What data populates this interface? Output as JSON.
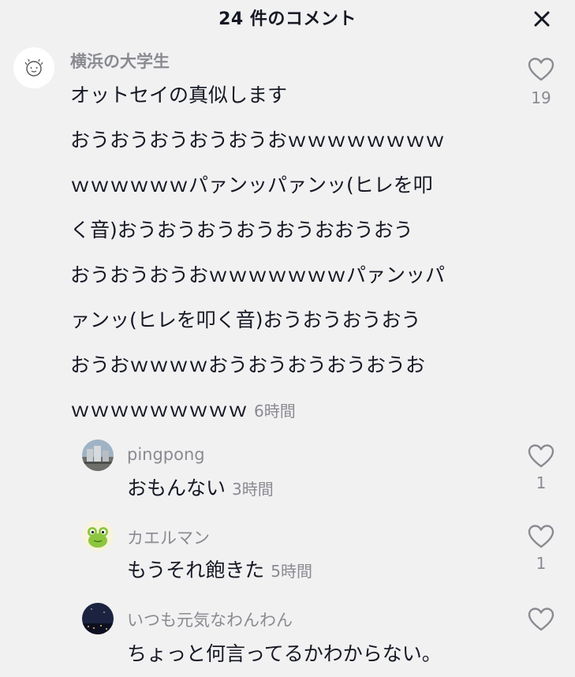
{
  "header": {
    "title": "24 件のコメント",
    "close_icon": "close-icon"
  },
  "comments": [
    {
      "username": "横浜の大学生",
      "avatar_icon": "default-avatar-icon",
      "lines": [
        "オットセイの真似します",
        "おうおうおうおうおうおｗｗｗｗｗｗｗｗ",
        "ｗｗｗｗｗｗパァンッパァンッ(ヒレを叩",
        "く音)おうおうおうおうおうおおうおう",
        "おうおうおうおｗｗｗｗｗｗｗパァンッパ",
        "ァンッ(ヒレを叩く音)おうおうおうおう",
        "おうおｗｗｗｗおうおうおうおうおうお",
        "ｗｗｗｗｗｗｗｗｗ"
      ],
      "timestamp": "6時間",
      "likes": "19"
    }
  ],
  "replies": [
    {
      "username": "pingpong",
      "avatar_icon": "photo-avatar-icon",
      "text": "おもんない",
      "timestamp": "3時間",
      "likes": "1"
    },
    {
      "username": "カエルマン",
      "avatar_icon": "frog-avatar-icon",
      "text": "もうそれ飽きた",
      "timestamp": "5時間",
      "likes": "1"
    },
    {
      "username": "いつも元気なわんわん",
      "avatar_icon": "night-photo-avatar-icon",
      "text": "ちょっと何言ってるかわからない。",
      "timestamp": "",
      "likes": ""
    }
  ],
  "colors": {
    "background": "#f1f1f2",
    "text": "#161823",
    "secondary_text": "#8a8b91"
  }
}
